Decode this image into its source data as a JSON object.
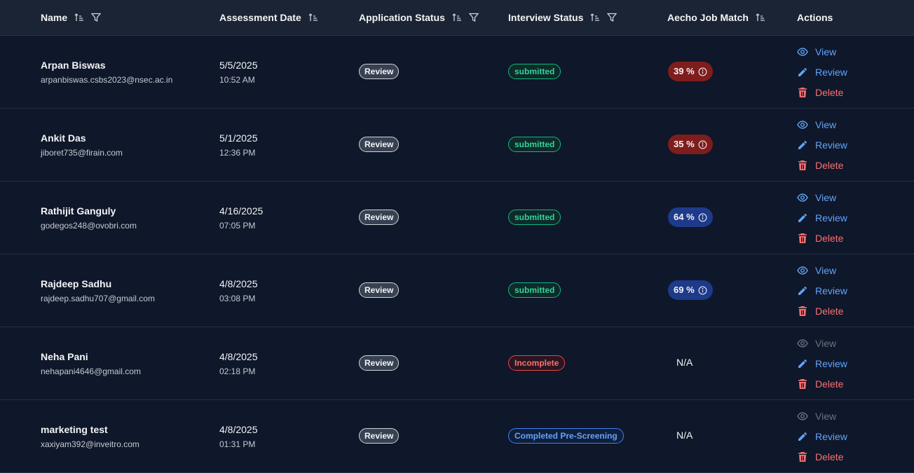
{
  "columns": {
    "name": "Name",
    "assessment_date": "Assessment Date",
    "application_status": "Application Status",
    "interview_status": "Interview Status",
    "job_match": "Aecho Job Match",
    "actions": "Actions"
  },
  "actions": {
    "view": "View",
    "review": "Review",
    "delete": "Delete"
  },
  "colors": {
    "background": "#0f172a",
    "header_background": "#1b2434",
    "accent_blue": "#60a5fa",
    "danger_red": "#f87171",
    "success_green": "#34d399",
    "match_low": "#7f1d1d",
    "match_high": "#1e3a8a"
  },
  "rows": [
    {
      "name": "Arpan Biswas",
      "email": "arpanbiswas.csbs2023@nsec.ac.in",
      "date": "5/5/2025",
      "time": "10:52 AM",
      "application_status": "Review",
      "interview_status": "submitted",
      "interview_variant": "green",
      "match": "39 %",
      "match_variant": "red",
      "view_enabled": true
    },
    {
      "name": "Ankit Das",
      "email": "jiboret735@firain.com",
      "date": "5/1/2025",
      "time": "12:36 PM",
      "application_status": "Review",
      "interview_status": "submitted",
      "interview_variant": "green",
      "match": "35 %",
      "match_variant": "red",
      "view_enabled": true
    },
    {
      "name": "Rathijit Ganguly",
      "email": "godegos248@ovobri.com",
      "date": "4/16/2025",
      "time": "07:05 PM",
      "application_status": "Review",
      "interview_status": "submitted",
      "interview_variant": "green",
      "match": "64 %",
      "match_variant": "blue",
      "view_enabled": true
    },
    {
      "name": "Rajdeep Sadhu",
      "email": "rajdeep.sadhu707@gmail.com",
      "date": "4/8/2025",
      "time": "03:08 PM",
      "application_status": "Review",
      "interview_status": "submitted",
      "interview_variant": "green",
      "match": "69 %",
      "match_variant": "blue",
      "view_enabled": true
    },
    {
      "name": "Neha Pani",
      "email": "nehapani4646@gmail.com",
      "date": "4/8/2025",
      "time": "02:18 PM",
      "application_status": "Review",
      "interview_status": "Incomplete",
      "interview_variant": "red",
      "match": "N/A",
      "match_variant": "none",
      "view_enabled": false
    },
    {
      "name": "marketing test",
      "email": "xaxiyam392@inveitro.com",
      "date": "4/8/2025",
      "time": "01:31 PM",
      "application_status": "Review",
      "interview_status": "Completed Pre-Screening",
      "interview_variant": "blue",
      "match": "N/A",
      "match_variant": "none",
      "view_enabled": false
    }
  ]
}
